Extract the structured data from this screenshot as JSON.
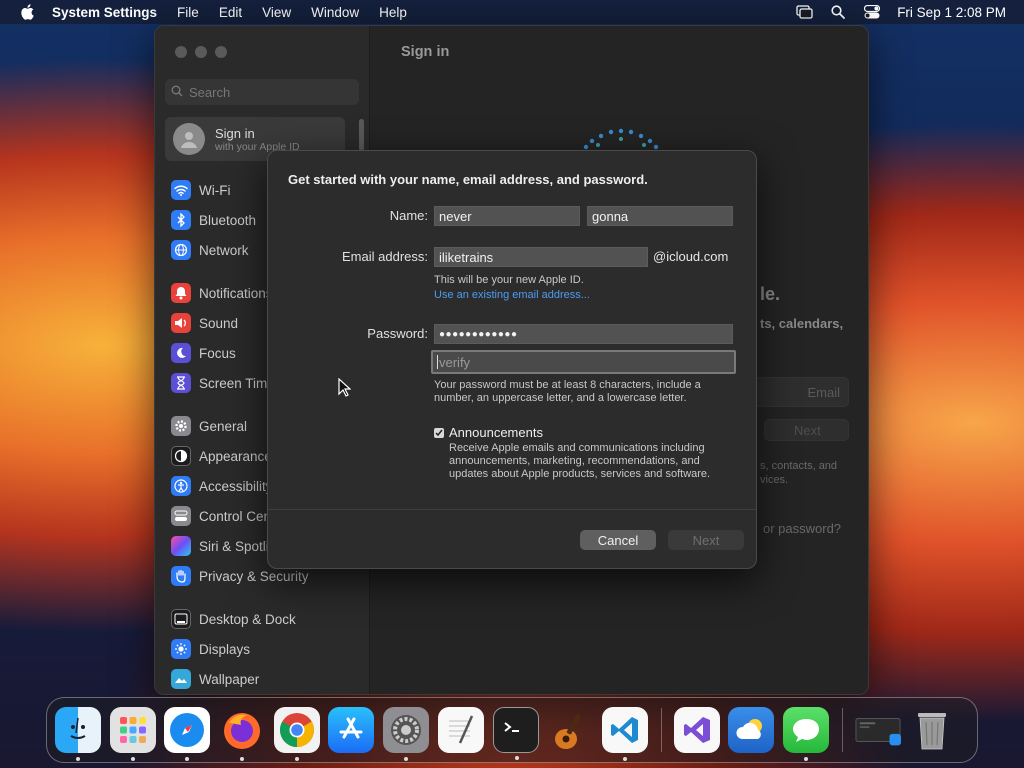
{
  "menubar": {
    "app_name": "System Settings",
    "menus": [
      "File",
      "Edit",
      "View",
      "Window",
      "Help"
    ],
    "datetime": "Fri Sep 1  2:08 PM"
  },
  "sidebar": {
    "search_placeholder": "Search",
    "signin_title": "Sign in",
    "signin_subtitle": "with your Apple ID",
    "items": [
      {
        "label": "Wi-Fi",
        "icon": "wifi-icon",
        "color": "#2f7cf6"
      },
      {
        "label": "Bluetooth",
        "icon": "bluetooth-icon",
        "color": "#2f7cf6"
      },
      {
        "label": "Network",
        "icon": "globe-icon",
        "color": "#2f7cf6"
      },
      {
        "label": "Notifications",
        "icon": "bell-icon",
        "color": "#e8423a"
      },
      {
        "label": "Sound",
        "icon": "speaker-icon",
        "color": "#e8423a"
      },
      {
        "label": "Focus",
        "icon": "moon-icon",
        "color": "#5b4fd6"
      },
      {
        "label": "Screen Time",
        "icon": "hourglass-icon",
        "color": "#5b4fd6"
      },
      {
        "label": "General",
        "icon": "gear-icon",
        "color": "#8a8a8e"
      },
      {
        "label": "Appearance",
        "icon": "appearance-icon",
        "color": "#1c1c1e"
      },
      {
        "label": "Accessibility",
        "icon": "accessibility-icon",
        "color": "#2f7cf6"
      },
      {
        "label": "Control Centre",
        "icon": "control-centre-icon",
        "color": "#8a8a8e"
      },
      {
        "label": "Siri & Spotlight",
        "icon": "siri-icon",
        "color": "#b13fd0"
      },
      {
        "label": "Privacy & Security",
        "icon": "hand-icon",
        "color": "#2f7cf6"
      },
      {
        "label": "Desktop & Dock",
        "icon": "dock-icon",
        "color": "#1c1c1e"
      },
      {
        "label": "Displays",
        "icon": "sun-icon",
        "color": "#2f7cf6"
      },
      {
        "label": "Wallpaper",
        "icon": "wallpaper-icon",
        "color": "#35a7d8"
      }
    ]
  },
  "main": {
    "title": "Sign in",
    "bg_frag_1": "le.",
    "bg_frag_2": "ts, calendars,",
    "bg_frag_3": "Email",
    "bg_frag_4": "Next",
    "bg_frag_5": "s, contacts, and",
    "bg_frag_6": "vices.",
    "bg_frag_7": "or password?"
  },
  "dialog": {
    "heading": "Get started with your name, email address, and password.",
    "name_label": "Name:",
    "first_name": "never",
    "last_name": "gonna",
    "email_label": "Email address:",
    "email_value": "iliketrains",
    "email_domain": "@icloud.com",
    "email_note": "This will be your new Apple ID.",
    "use_existing_link": "Use an existing email address...",
    "password_label": "Password:",
    "password_value": "●●●●●●●●●●●●",
    "verify_placeholder": "verify",
    "password_hint_1": "Your password must be at least 8 characters, include a",
    "password_hint_2": "number, an uppercase letter, and a lowercase letter.",
    "announcements_label": "Announcements",
    "announcements_checked": true,
    "announcements_desc_1": "Receive Apple emails and communications including",
    "announcements_desc_2": "announcements, marketing, recommendations, and",
    "announcements_desc_3": "updates about Apple products, services and software.",
    "cancel_label": "Cancel",
    "next_label": "Next"
  },
  "dock": {
    "apps": [
      {
        "name": "finder-icon",
        "color": "#3a8ef0",
        "running": true
      },
      {
        "name": "launchpad-icon",
        "color": "#d9d9d9",
        "running": true
      },
      {
        "name": "safari-icon",
        "color": "#1a8cf0",
        "running": true
      },
      {
        "name": "firefox-icon",
        "color": "#ff6a2a",
        "running": true
      },
      {
        "name": "chrome-icon",
        "color": "#f2f2f2",
        "running": true
      },
      {
        "name": "app-store-icon",
        "color": "#1b8df5",
        "running": false
      },
      {
        "name": "system-settings-icon",
        "color": "#8a8a8e",
        "running": true
      },
      {
        "name": "textedit-icon",
        "color": "#f4f4f4",
        "running": false
      },
      {
        "name": "terminal-icon",
        "color": "#1e1e1e",
        "running": true
      },
      {
        "name": "garageband-icon",
        "color": "#3a3a3a",
        "running": false
      },
      {
        "name": "vscode-icon",
        "color": "#f5f5f5",
        "running": true
      },
      {
        "name": "visual-studio-icon",
        "color": "#f5f5f5",
        "running": false
      },
      {
        "name": "weather-icon",
        "color": "#2d7fdc",
        "running": false
      },
      {
        "name": "messages-icon",
        "color": "#36c64a",
        "running": true
      }
    ]
  }
}
